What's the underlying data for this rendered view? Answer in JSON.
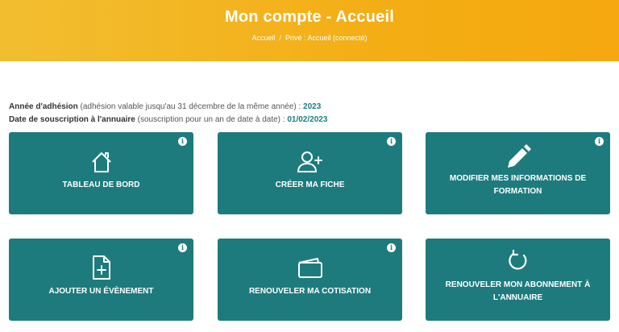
{
  "header": {
    "title": "Mon compte - Accueil",
    "breadcrumb": {
      "home": "Accueil",
      "separator": "/",
      "current": "Privé : Accueil (connecté)"
    }
  },
  "info": {
    "line1_label": "Année d'adhésion",
    "line1_note": "(adhésion valable jusqu'au 31 décembre de la même année) :",
    "line1_value": "2023",
    "line2_label": "Date de souscription à l'annuaire",
    "line2_note": "(souscription pour un an de date à date) :",
    "line2_value": "01/02/2023"
  },
  "tiles": [
    {
      "label": "TABLEAU DE BORD",
      "icon": "home-icon",
      "has_info": true
    },
    {
      "label": "CRÉER MA FICHE",
      "icon": "user-plus-icon",
      "has_info": true
    },
    {
      "label": "MODIFIER MES INFORMATIONS DE FORMATION",
      "icon": "pencil-icon",
      "has_info": true
    },
    {
      "label": "AJOUTER UN ÉVÈNEMENT",
      "icon": "file-plus-icon",
      "has_info": true
    },
    {
      "label": "RENOUVELER MA COTISATION",
      "icon": "wallet-icon",
      "has_info": true
    },
    {
      "label": "RENOUVELER MON ABONNEMENT À L'ANNUAIRE",
      "icon": "refresh-icon",
      "has_info": false
    }
  ],
  "info_glyph": "i",
  "colors": {
    "banner": "#f4ae15",
    "tile": "#1e7b7d",
    "accent_value": "#1a7d7f"
  }
}
